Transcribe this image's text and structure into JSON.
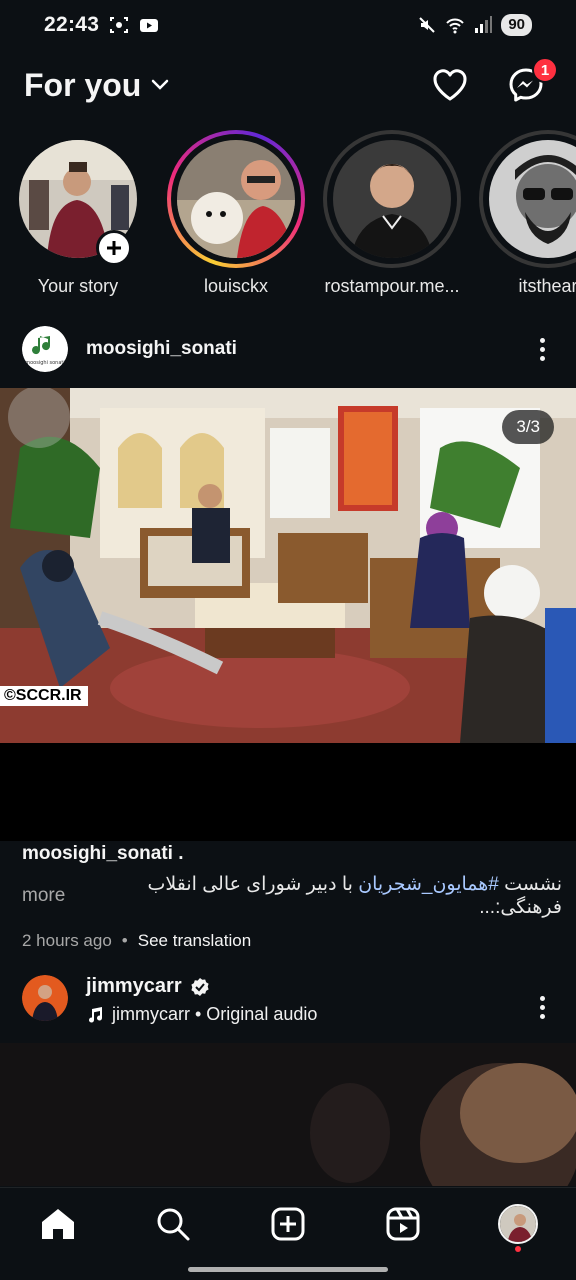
{
  "status_bar": {
    "time": "22:43",
    "battery": "90"
  },
  "header": {
    "feed_title": "For you",
    "notifications_badge": "1"
  },
  "stories": [
    {
      "label": "Your story",
      "ring": "none",
      "has_add": true
    },
    {
      "label": "louisckx",
      "ring": "unseen"
    },
    {
      "label": "rostampour.me...",
      "ring": "seen"
    },
    {
      "label": "itsthear",
      "ring": "seen"
    }
  ],
  "post1": {
    "username": "moosighi_sonati",
    "avatar_text": "moosighi sonati",
    "media_counter": "3/3",
    "watermark": "©SCCR.IR",
    "caption_user": "moosighi_sonati .",
    "caption_more": "more",
    "caption_before": "نشست ",
    "caption_hashtag": "#همایون_شجریان",
    "caption_after": " با دبیر شورای عالی انقلاب فرهنگی:...",
    "time_ago": "2 hours ago",
    "see_translation": "See translation"
  },
  "post2": {
    "username": "jimmycarr",
    "audio": "jimmycarr • Original audio"
  },
  "colors": {
    "background": "#0c1014",
    "badge": "#ff3040",
    "hashtag": "#a9c9ff"
  }
}
